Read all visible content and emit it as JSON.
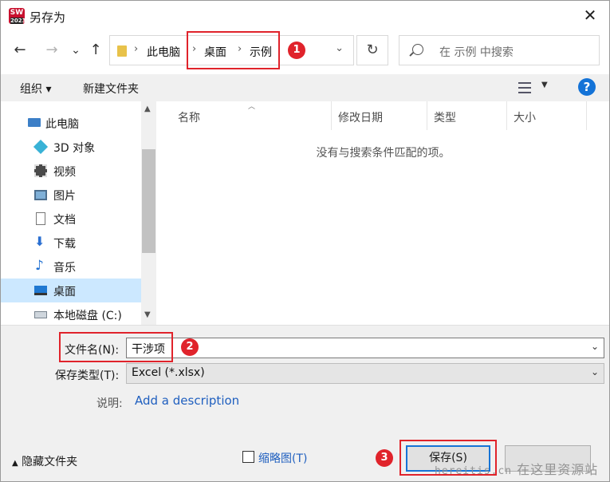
{
  "window": {
    "title": "另存为",
    "app_logo_text": "SW",
    "app_logo_sub": "2023"
  },
  "nav": {
    "back": "←",
    "forward": "→",
    "recent": "⌄",
    "up": "↑",
    "refresh": "↻"
  },
  "address": {
    "crumbs": [
      "此电脑",
      "桌面",
      "示例"
    ],
    "separator": "›",
    "chevron": "⌄"
  },
  "search": {
    "placeholder": "在 示例 中搜索"
  },
  "toolbar": {
    "organize": "组织 ▾",
    "new_folder": "新建文件夹",
    "help": "?"
  },
  "sidebar": {
    "items": [
      {
        "label": "此电脑",
        "icon": "pc-icon"
      },
      {
        "label": "3D 对象",
        "icon": "cube-icon"
      },
      {
        "label": "视频",
        "icon": "video-icon"
      },
      {
        "label": "图片",
        "icon": "picture-icon"
      },
      {
        "label": "文档",
        "icon": "document-icon"
      },
      {
        "label": "下载",
        "icon": "download-icon"
      },
      {
        "label": "音乐",
        "icon": "music-icon"
      },
      {
        "label": "桌面",
        "icon": "desktop-icon",
        "selected": true
      },
      {
        "label": "本地磁盘 (C:)",
        "icon": "drive-icon"
      }
    ]
  },
  "columns": [
    "名称",
    "修改日期",
    "类型",
    "大小"
  ],
  "empty_message": "没有与搜索条件匹配的项。",
  "form": {
    "filename_label": "文件名(N):",
    "filename_value": "干涉项",
    "filetype_label": "保存类型(T):",
    "filetype_value": "Excel (*.xlsx)",
    "desc_label": "说明:",
    "desc_link": "Add a description",
    "hide_folders": "隐藏文件夹",
    "thumbnail_label": "缩略图(T)",
    "save_button": "保存(S)",
    "cancel_button": ""
  },
  "markers": [
    "1",
    "2",
    "3"
  ],
  "watermark": {
    "small": "hereitis.cn",
    "large": "在这里资源站"
  },
  "colors": {
    "accent": "#1673d6",
    "annotation": "#e0232b",
    "selection": "#cce8ff"
  }
}
